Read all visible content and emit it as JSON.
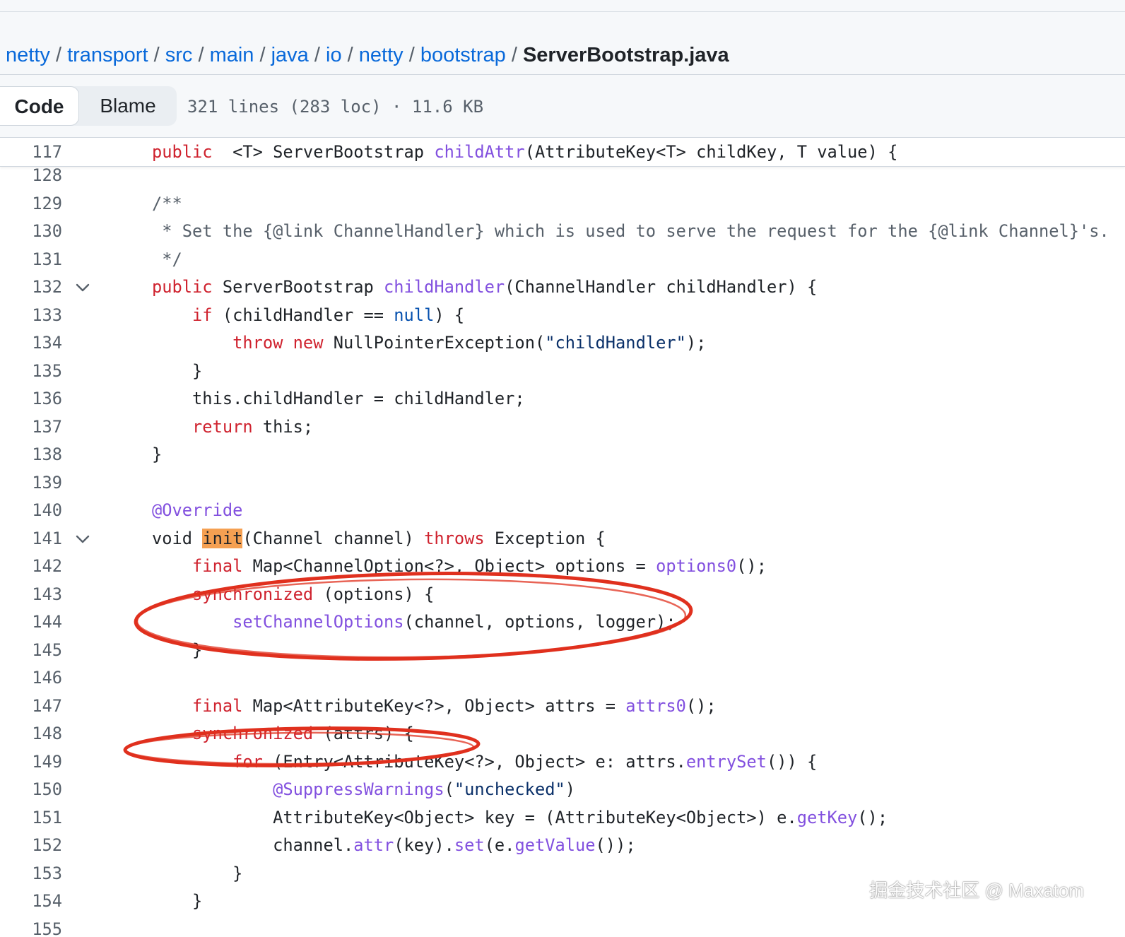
{
  "breadcrumb": {
    "items": [
      "netty",
      "transport",
      "src",
      "main",
      "java",
      "io",
      "netty",
      "bootstrap"
    ],
    "separator": "/",
    "current": "ServerBootstrap.java"
  },
  "toolbar": {
    "code_label": "Code",
    "blame_label": "Blame",
    "file_info": "321 lines (283 loc) · 11.6 KB"
  },
  "colors": {
    "keyword": "#cf222e",
    "function": "#8250df",
    "comment": "#57606a",
    "string": "#0a3069",
    "constant": "#0550ae",
    "search_highlight": "#f5a052",
    "annotation_circle": "#e0301e"
  },
  "sticky_line": {
    "number": "117",
    "tokens": [
      [
        "kw",
        "public"
      ],
      [
        "",
        "  <T> ServerBootstrap "
      ],
      [
        "fn",
        "childAttr"
      ],
      [
        "",
        "(AttributeKey<T> childKey, T value) {"
      ]
    ]
  },
  "lines": [
    {
      "n": "128",
      "fold": false,
      "t": []
    },
    {
      "n": "129",
      "fold": false,
      "t": [
        [
          "cm",
          "/**"
        ]
      ]
    },
    {
      "n": "130",
      "fold": false,
      "t": [
        [
          "cm",
          " * Set the {@link ChannelHandler} which is used to serve the request for the {@link Channel}'s."
        ]
      ]
    },
    {
      "n": "131",
      "fold": false,
      "t": [
        [
          "cm",
          " */"
        ]
      ]
    },
    {
      "n": "132",
      "fold": true,
      "t": [
        [
          "kw",
          "public"
        ],
        [
          "",
          " ServerBootstrap "
        ],
        [
          "fn",
          "childHandler"
        ],
        [
          "",
          "(ChannelHandler childHandler) {"
        ]
      ]
    },
    {
      "n": "133",
      "fold": false,
      "t": [
        [
          "",
          "    "
        ],
        [
          "kw",
          "if"
        ],
        [
          "",
          " (childHandler == "
        ],
        [
          "con",
          "null"
        ],
        [
          "",
          ") {"
        ]
      ]
    },
    {
      "n": "134",
      "fold": false,
      "t": [
        [
          "",
          "        "
        ],
        [
          "kw",
          "throw"
        ],
        [
          "",
          " "
        ],
        [
          "kw",
          "new"
        ],
        [
          "",
          " NullPointerException("
        ],
        [
          "str",
          "\"childHandler\""
        ],
        [
          "",
          ");"
        ]
      ]
    },
    {
      "n": "135",
      "fold": false,
      "t": [
        [
          "",
          "    }"
        ]
      ]
    },
    {
      "n": "136",
      "fold": false,
      "t": [
        [
          "",
          "    this.childHandler = childHandler;"
        ]
      ]
    },
    {
      "n": "137",
      "fold": false,
      "t": [
        [
          "",
          "    "
        ],
        [
          "kw",
          "return"
        ],
        [
          "",
          " this;"
        ]
      ]
    },
    {
      "n": "138",
      "fold": false,
      "t": [
        [
          "",
          "}"
        ]
      ]
    },
    {
      "n": "139",
      "fold": false,
      "t": []
    },
    {
      "n": "140",
      "fold": false,
      "t": [
        [
          "fn",
          "@Override"
        ]
      ]
    },
    {
      "n": "141",
      "fold": true,
      "t": [
        [
          "",
          "void "
        ],
        [
          "hl",
          "init"
        ],
        [
          "",
          "(Channel channel) "
        ],
        [
          "kw",
          "throws"
        ],
        [
          "",
          " Exception {"
        ]
      ]
    },
    {
      "n": "142",
      "fold": false,
      "t": [
        [
          "",
          "    "
        ],
        [
          "kw",
          "final"
        ],
        [
          "",
          " Map<ChannelOption<?>, Object> options = "
        ],
        [
          "fn",
          "options0"
        ],
        [
          "",
          "();"
        ]
      ]
    },
    {
      "n": "143",
      "fold": false,
      "t": [
        [
          "",
          "    "
        ],
        [
          "kw",
          "synchronized"
        ],
        [
          "",
          " (options) {"
        ]
      ]
    },
    {
      "n": "144",
      "fold": false,
      "t": [
        [
          "",
          "        "
        ],
        [
          "fn",
          "setChannelOptions"
        ],
        [
          "",
          "(channel, options, logger);"
        ]
      ]
    },
    {
      "n": "145",
      "fold": false,
      "t": [
        [
          "",
          "    }"
        ]
      ]
    },
    {
      "n": "146",
      "fold": false,
      "t": []
    },
    {
      "n": "147",
      "fold": false,
      "t": [
        [
          "",
          "    "
        ],
        [
          "kw",
          "final"
        ],
        [
          "",
          " Map<AttributeKey<?>, Object> attrs = "
        ],
        [
          "fn",
          "attrs0"
        ],
        [
          "",
          "();"
        ]
      ]
    },
    {
      "n": "148",
      "fold": false,
      "t": [
        [
          "",
          "    "
        ],
        [
          "kw",
          "synchronized"
        ],
        [
          "",
          " (attrs) {"
        ]
      ]
    },
    {
      "n": "149",
      "fold": false,
      "t": [
        [
          "",
          "        "
        ],
        [
          "kw",
          "for"
        ],
        [
          "",
          " (Entry<AttributeKey<?>, Object> e: attrs."
        ],
        [
          "fn",
          "entrySet"
        ],
        [
          "",
          "()) {"
        ]
      ]
    },
    {
      "n": "150",
      "fold": false,
      "t": [
        [
          "",
          "            "
        ],
        [
          "fn",
          "@SuppressWarnings"
        ],
        [
          "",
          "("
        ],
        [
          "str",
          "\"unchecked\""
        ],
        [
          "",
          ")"
        ]
      ]
    },
    {
      "n": "151",
      "fold": false,
      "t": [
        [
          "",
          "            AttributeKey<Object> key = (AttributeKey<Object>) e."
        ],
        [
          "fn",
          "getKey"
        ],
        [
          "",
          "();"
        ]
      ]
    },
    {
      "n": "152",
      "fold": false,
      "t": [
        [
          "",
          "            channel."
        ],
        [
          "fn",
          "attr"
        ],
        [
          "",
          "(key)."
        ],
        [
          "fn",
          "set"
        ],
        [
          "",
          "(e."
        ],
        [
          "fn",
          "getValue"
        ],
        [
          "",
          "());"
        ]
      ]
    },
    {
      "n": "153",
      "fold": false,
      "t": [
        [
          "",
          "        }"
        ]
      ]
    },
    {
      "n": "154",
      "fold": false,
      "t": [
        [
          "",
          "    }"
        ]
      ]
    },
    {
      "n": "155",
      "fold": false,
      "t": []
    }
  ],
  "watermark": "掘金技术社区 @ Maxatom"
}
